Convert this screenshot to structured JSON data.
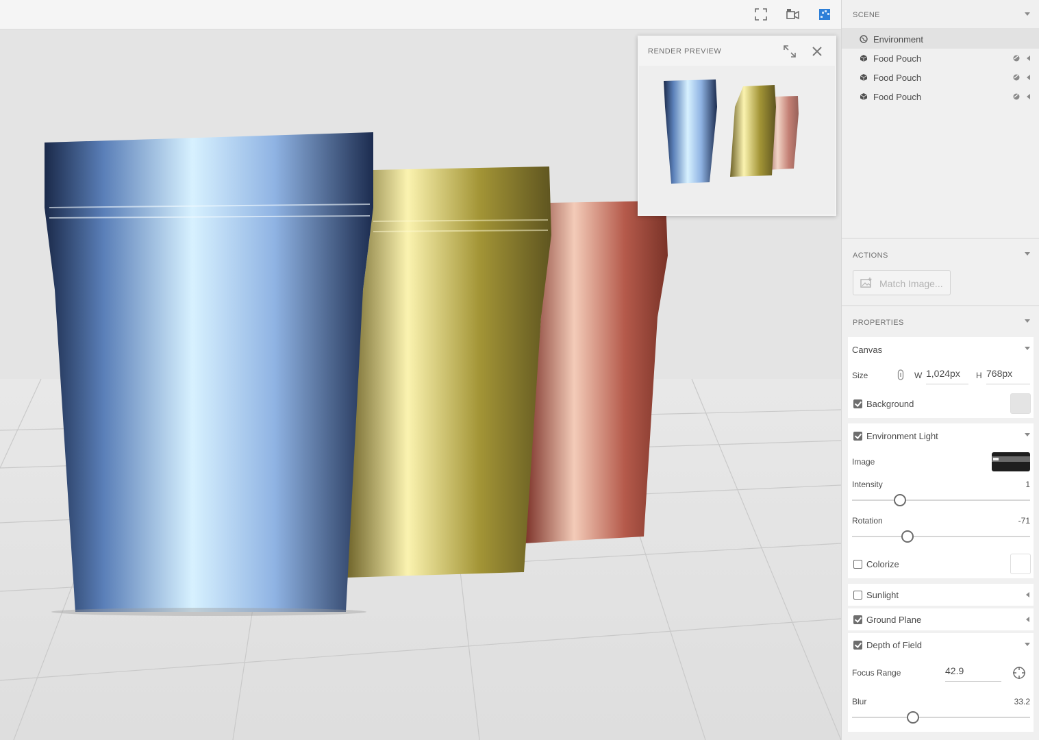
{
  "viewport": {
    "toolbar": {
      "fullscreen_icon": "fullscreen-icon",
      "camera_icon": "camera-icon",
      "render_icon": "render-preview-icon"
    },
    "pouch_colors": {
      "blue": "#7fa4d6",
      "gold": "#c9b95a",
      "red": "#c36b5d"
    }
  },
  "render_preview": {
    "title": "RENDER PREVIEW",
    "expand_icon": "expand-icon",
    "close_icon": "close-icon"
  },
  "scene": {
    "title": "SCENE",
    "items": [
      {
        "label": "Environment",
        "icon": "globe-icon",
        "selected": true
      },
      {
        "label": "Food Pouch",
        "icon": "cube-icon"
      },
      {
        "label": "Food Pouch",
        "icon": "cube-icon"
      },
      {
        "label": "Food Pouch",
        "icon": "cube-icon"
      }
    ]
  },
  "actions": {
    "title": "ACTIONS",
    "match_image_label": "Match Image..."
  },
  "properties": {
    "title": "PROPERTIES",
    "canvas": {
      "title": "Canvas",
      "size_label": "Size",
      "w_label": "W",
      "w_value": "1,024px",
      "h_label": "H",
      "h_value": "768px",
      "background_label": "Background",
      "background_checked": true,
      "background_color": "#e4e4e4"
    },
    "environment_light": {
      "title": "Environment Light",
      "checked": true,
      "image_label": "Image",
      "intensity_label": "Intensity",
      "intensity_value": "1",
      "rotation_label": "Rotation",
      "rotation_value": "-71",
      "colorize_label": "Colorize",
      "colorize_checked": false
    },
    "sunlight": {
      "label": "Sunlight",
      "checked": false
    },
    "ground_plane": {
      "label": "Ground Plane",
      "checked": true
    },
    "depth_of_field": {
      "label": "Depth of Field",
      "checked": true,
      "focus_range_label": "Focus Range",
      "focus_range_value": "42.9",
      "blur_label": "Blur",
      "blur_value": "33.2"
    }
  }
}
